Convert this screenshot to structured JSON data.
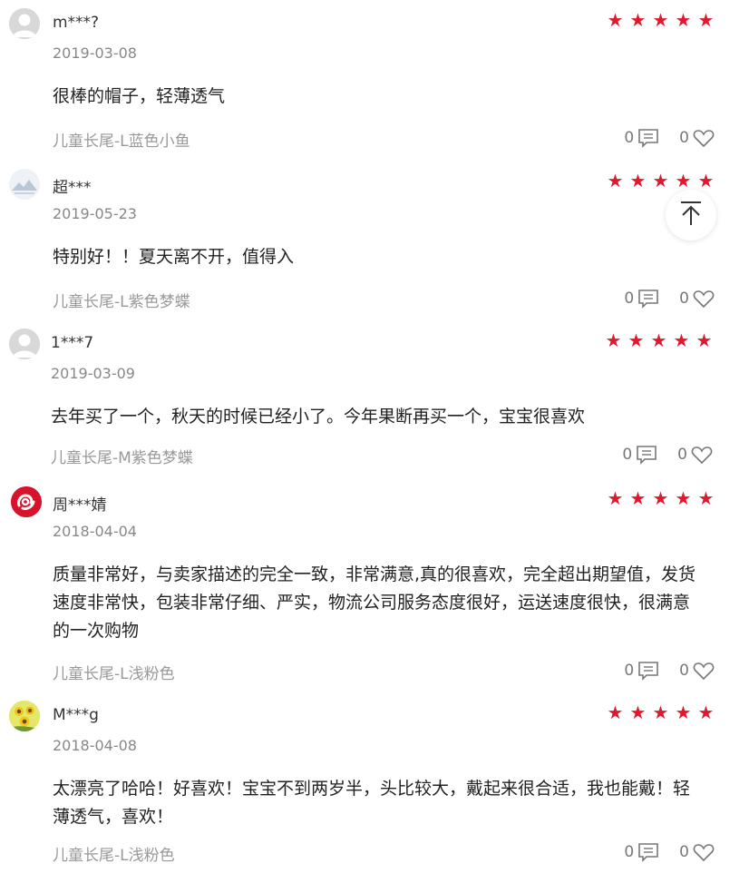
{
  "reviews": [
    {
      "username": "m***?",
      "date": "2019-03-08",
      "rating": 5,
      "content": "很棒的帽子，轻薄透气",
      "spec": "儿童长尾-L蓝色小鱼",
      "comments": "0",
      "likes": "0",
      "avatar": "default-avatar-icon"
    },
    {
      "username": "超***",
      "date": "2019-05-23",
      "rating": 5,
      "content": "特别好！！夏天离不开，值得入",
      "spec": "儿童长尾-L紫色梦蝶",
      "comments": "0",
      "likes": "0",
      "avatar": "landscape-avatar-icon"
    },
    {
      "username": "1***7",
      "date": "2019-03-09",
      "rating": 5,
      "content": "去年买了一个，秋天的时候已经小了。今年果断再买一个，宝宝很喜欢",
      "spec": "儿童长尾-M紫色梦蝶",
      "comments": "0",
      "likes": "0",
      "avatar": "default-avatar-icon"
    },
    {
      "username": "周***婧",
      "date": "2018-04-04",
      "rating": 5,
      "content": "质量非常好，与卖家描述的完全一致，非常满意,真的很喜欢，完全超出期望值，发货速度非常快，包装非常仔细、严实，物流公司服务态度很好，运送速度很快，很满意的一次购物",
      "spec": "儿童长尾-L浅粉色",
      "comments": "0",
      "likes": "0",
      "avatar": "red-logo-avatar-icon"
    },
    {
      "username": "M***g",
      "date": "2018-04-08",
      "rating": 5,
      "content": "太漂亮了哈哈！好喜欢！宝宝不到两岁半，头比较大，戴起来很合适，我也能戴！轻薄透气，喜欢！",
      "spec": "儿童长尾-L浅粉色",
      "comments": "0",
      "likes": "0",
      "avatar": "sunflower-avatar-icon"
    }
  ],
  "colors": {
    "star": "#e1192f",
    "muted": "#999999",
    "date": "#888888"
  },
  "back_to_top_icon": "arrow-up-icon"
}
